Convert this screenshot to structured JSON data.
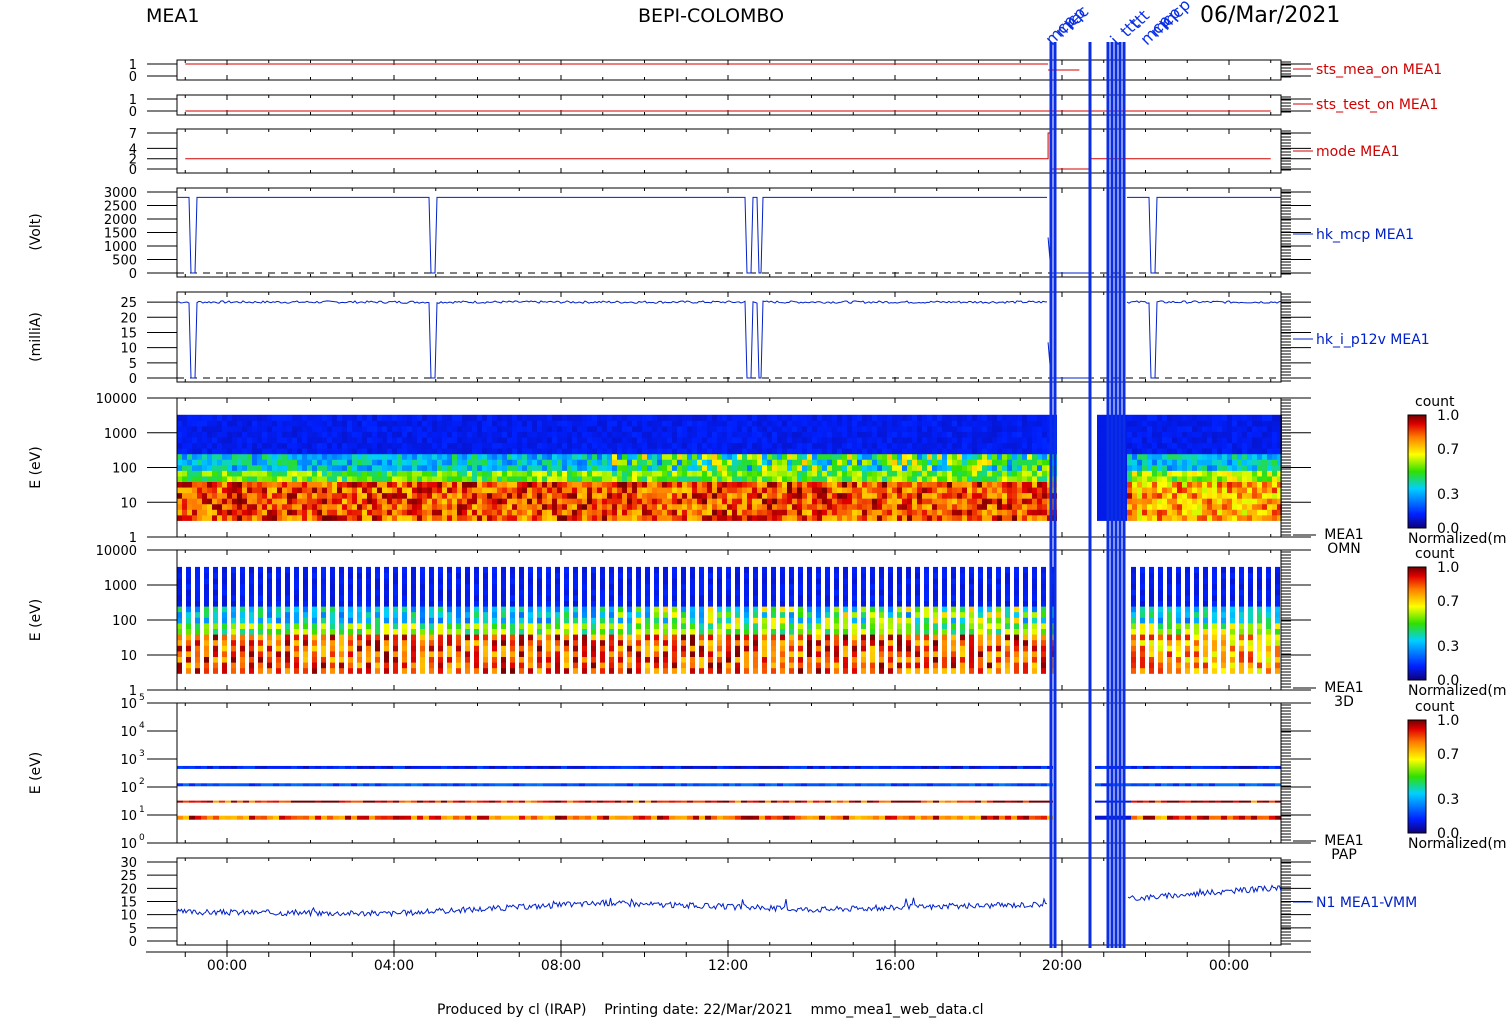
{
  "header": {
    "instrument": "MEA1",
    "mission": "BEPI-COLOMBO",
    "date": "06/Mar/2021"
  },
  "footer": {
    "text": "Produced by cl (IRAP)    Printing date: 22/Mar/2021    mmo_mea1_web_data.cl"
  },
  "colors": {
    "red_line": "#d00000",
    "blue_line": "#0020c8",
    "marker_blue": "#0a2ee6"
  },
  "chart_data": [
    {
      "type": "line",
      "name": "sts_mea_on MEA1",
      "ylim": [
        0,
        1
      ],
      "ytick_labels": [
        "0",
        "1"
      ],
      "segments": [
        {
          "x": [
            "-01:00",
            "19:40"
          ],
          "y": 1
        },
        {
          "x": [
            "19:40",
            "20:25"
          ],
          "y": 1
        }
      ]
    },
    {
      "type": "line",
      "name": "sts_test_on MEA1",
      "ylim": [
        0,
        1
      ],
      "ytick_labels": [
        "0",
        "1"
      ],
      "segments": [
        {
          "x": [
            "-01:00",
            "25:00"
          ],
          "y": 0
        }
      ]
    },
    {
      "type": "line",
      "name": "mode MEA1",
      "ylim": [
        0,
        7
      ],
      "ytick_labels": [
        "0",
        "2",
        "4",
        "7"
      ],
      "segments": [
        {
          "x": [
            "-01:00",
            "19:40"
          ],
          "y": 2
        },
        {
          "x": [
            "19:40",
            "19:45"
          ],
          "y": 7
        },
        {
          "x": [
            "19:45",
            "20:40"
          ],
          "y": 0
        },
        {
          "x": [
            "20:40",
            "25:00"
          ],
          "y": 2
        }
      ]
    },
    {
      "type": "line",
      "name": "hk_mcp MEA1",
      "ylabel": "(Volt)",
      "ylim": [
        0,
        3000
      ],
      "ytick_labels": [
        "0",
        "500",
        "1000",
        "1500",
        "2000",
        "2500",
        "3000"
      ],
      "baseline": 2800,
      "dips_to": 0,
      "dip_times": [
        "-00:50",
        "04:55",
        "12:30",
        "12:45",
        "22:10"
      ],
      "end_time": "19:40"
    },
    {
      "type": "line",
      "name": "hk_i_p12v MEA1",
      "ylabel": "(milliA)",
      "ylim": [
        0,
        27
      ],
      "ytick_labels": [
        "0",
        "5",
        "10",
        "15",
        "20",
        "25"
      ],
      "baseline": 25,
      "dips_to": 0,
      "dip_times": [
        "-00:50",
        "04:55",
        "12:30",
        "12:45",
        "22:10"
      ],
      "end_time": "19:40"
    },
    {
      "type": "heatmap",
      "name": "MEA1 OMN",
      "name_lines": [
        "MEA1",
        "OMN"
      ],
      "ylabel": "E (eV)",
      "yscale": "log",
      "ylim": [
        1,
        10000
      ],
      "ytick_labels": [
        "1",
        "10",
        "100",
        "1000",
        "10000"
      ],
      "colorbar": {
        "title": "count",
        "ticks": [
          "0.0",
          "0.3",
          "0.7",
          "1.0"
        ],
        "label": "Normalized(m"
      }
    },
    {
      "type": "heatmap",
      "name": "MEA1 3D",
      "name_lines": [
        "MEA1",
        "3D"
      ],
      "ylabel": "E (eV)",
      "yscale": "log",
      "ylim": [
        1,
        10000
      ],
      "ytick_labels": [
        "1",
        "10",
        "100",
        "1000",
        "10000"
      ],
      "colorbar": {
        "title": "count",
        "ticks": [
          "0.0",
          "0.3",
          "0.7",
          "1.0"
        ],
        "label": "Normalized(m"
      }
    },
    {
      "type": "heatmap",
      "name": "MEA1 PAP",
      "name_lines": [
        "MEA1",
        "PAP"
      ],
      "ylabel": "E (eV)",
      "yscale": "log",
      "ylim": [
        1,
        100000
      ],
      "ytick_labels": [
        "10",
        "10",
        "10",
        "10",
        "10",
        "10"
      ],
      "ytick_exponents": [
        "0",
        "1",
        "2",
        "3",
        "4",
        "5"
      ],
      "colorbar": {
        "title": "count",
        "ticks": [
          "0.0",
          "0.3",
          "0.7",
          "1.0"
        ],
        "label": "Normalized(m"
      }
    },
    {
      "type": "line",
      "name": "N1 MEA1-VMM",
      "ylim": [
        0,
        30
      ],
      "ytick_labels": [
        "0",
        "5",
        "10",
        "15",
        "20",
        "25",
        "30"
      ],
      "approx_levels": [
        {
          "x": "-01:00",
          "y": 11
        },
        {
          "x": "04:00",
          "y": 10.5
        },
        {
          "x": "09:00",
          "y": 14.5
        },
        {
          "x": "14:00",
          "y": 12
        },
        {
          "x": "19:40",
          "y": 14
        },
        {
          "x": "21:30",
          "y": 16
        },
        {
          "x": "25:00",
          "y": 20
        }
      ]
    }
  ],
  "x_axis": {
    "range": [
      "-01:10",
      "25:10"
    ],
    "tick_labels": [
      "00:00",
      "04:00",
      "08:00",
      "12:00",
      "16:00",
      "20:00",
      "00:00"
    ]
  },
  "events": {
    "labels": [
      "mcp",
      "mcp",
      "rec",
      "i",
      "ttt",
      "ttt",
      "mcp",
      "mcp",
      "mcp"
    ]
  }
}
